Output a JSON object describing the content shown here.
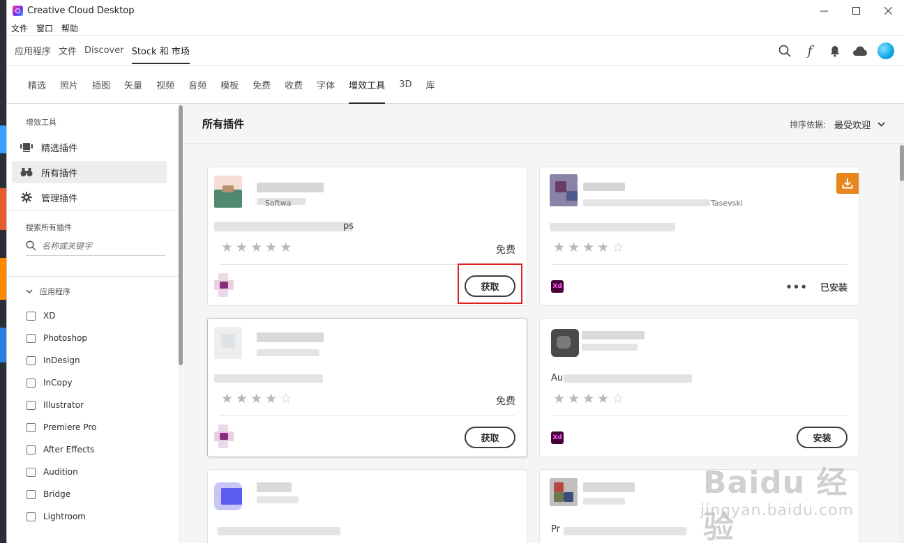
{
  "window": {
    "title": "Creative Cloud Desktop"
  },
  "menu": [
    "文件",
    "窗口",
    "帮助"
  ],
  "topnav": {
    "tabs": [
      "应用程序",
      "文件",
      "Discover",
      "Stock 和 市场"
    ],
    "active": "Stock 和 市场"
  },
  "subnav": {
    "tabs": [
      "精选",
      "照片",
      "插图",
      "矢量",
      "视频",
      "音频",
      "模板",
      "免费",
      "收费",
      "字体",
      "增效工具",
      "3D",
      "库"
    ],
    "active": "增效工具"
  },
  "sidebar": {
    "section_title": "增效工具",
    "items": [
      "精选插件",
      "所有插件",
      "管理插件"
    ],
    "active_item": "所有插件",
    "search_label": "搜索所有插件",
    "search_placeholder": "名称或关键字",
    "apps_heading": "应用程序",
    "apps": [
      "XD",
      "Photoshop",
      "InDesign",
      "InCopy",
      "Illustrator",
      "Premiere Pro",
      "After Effects",
      "Audition",
      "Bridge",
      "Lightroom"
    ]
  },
  "main": {
    "title": "所有插件",
    "sort_label": "排序依据:",
    "sort_value": "最受欢迎"
  },
  "cards": [
    {
      "text_fragment": "ps",
      "subtitle_fragment": "Softwa",
      "rating": 5,
      "price": "免费",
      "action": "获取"
    },
    {
      "text_fragment": "",
      "subtitle_fragment": "Tasevski",
      "rating": 4,
      "price": "",
      "action": "已安装",
      "more": "•••",
      "app_badge": "Xd"
    },
    {
      "text_fragment": "",
      "subtitle_fragment": "",
      "rating": 4,
      "price": "免费",
      "action": "获取"
    },
    {
      "text_fragment": "Au",
      "subtitle_fragment": "",
      "rating": 4,
      "price": "",
      "action": "安装",
      "app_badge": "Xd"
    },
    {
      "text_fragment": "",
      "subtitle_fragment": "",
      "rating": 0,
      "price": "",
      "action": ""
    },
    {
      "text_fragment": "Pr",
      "subtitle_fragment": "",
      "rating": 0,
      "price": "",
      "action": ""
    }
  ],
  "watermark": {
    "main": "Baidu 经验",
    "sub": "jingyan.baidu.com"
  },
  "colors": {
    "accent_orange": "#e8871e",
    "xd_bg": "#470137",
    "xd_fg": "#ff61f6",
    "highlight_red": "#e02020"
  }
}
